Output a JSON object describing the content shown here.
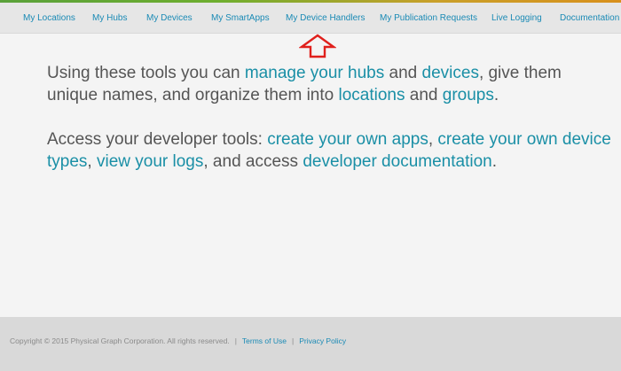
{
  "nav": {
    "items": [
      {
        "label": "My Locations"
      },
      {
        "label": "My Hubs"
      },
      {
        "label": "My Devices"
      },
      {
        "label": "My SmartApps"
      },
      {
        "label": "My Device Handlers"
      },
      {
        "label": "My Publication Requests"
      },
      {
        "label": "Live Logging"
      },
      {
        "label": "Documentation"
      }
    ]
  },
  "content": {
    "p1": {
      "t1": "Using these tools you can ",
      "link1": "manage your hubs",
      "t2": " and ",
      "link2": "devices",
      "t3": ", give them unique names, and organize them into ",
      "link3": "locations",
      "t4": " and ",
      "link4": "groups",
      "t5": "."
    },
    "p2": {
      "t1": "Access your developer tools: ",
      "link1": "create your own apps",
      "t2": ", ",
      "link2": "create your own device types",
      "t3": ", ",
      "link3": "view your logs",
      "t4": ", and access ",
      "link4": "developer documentation",
      "t5": "."
    }
  },
  "annotation": {
    "arrow_icon": "up-arrow-outline",
    "color": "#e0201c"
  },
  "footer": {
    "copyright": "Copyright © 2015 Physical Graph Corporation. All rights reserved.",
    "sep1": "|",
    "terms": "Terms of Use",
    "sep2": "|",
    "privacy": "Privacy Policy"
  },
  "colors": {
    "link": "#1a8fa6",
    "nav_link": "#1a8ab5",
    "text": "#555555",
    "nav_bg": "#e6e6e6",
    "footer_bg": "#d9d9d9"
  }
}
